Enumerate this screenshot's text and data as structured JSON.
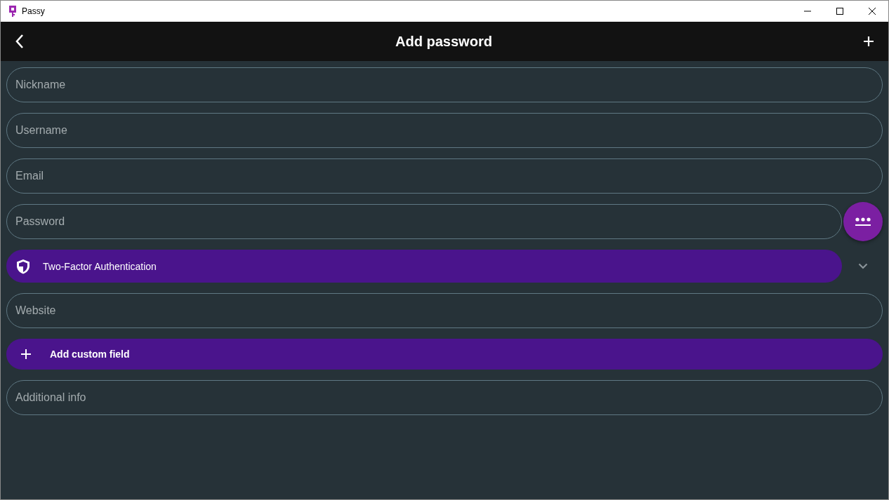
{
  "window": {
    "title": "Passy"
  },
  "app_bar": {
    "title": "Add password"
  },
  "fields": [
    {
      "kind": "text",
      "placeholder": "Nickname"
    },
    {
      "kind": "text",
      "placeholder": "Username"
    },
    {
      "kind": "text",
      "placeholder": "Email"
    },
    {
      "kind": "password",
      "placeholder": "Password"
    },
    {
      "kind": "expander",
      "label": "Two-Factor Authentication",
      "expanded": false
    },
    {
      "kind": "text",
      "placeholder": "Website"
    },
    {
      "kind": "action",
      "label": "Add custom field"
    },
    {
      "kind": "text",
      "placeholder": "Additional info"
    }
  ]
}
